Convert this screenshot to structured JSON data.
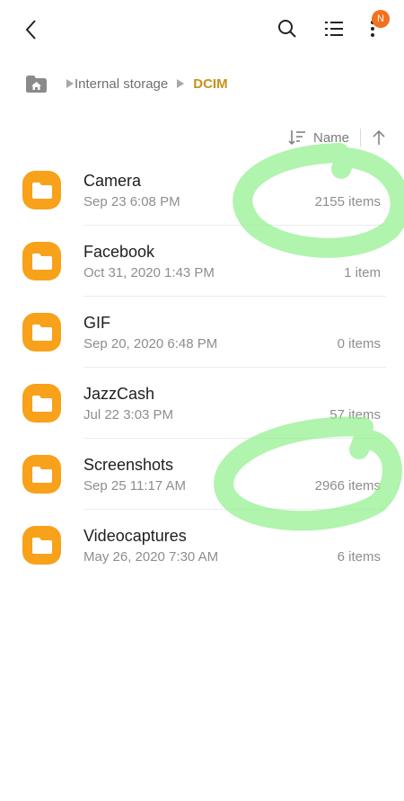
{
  "topbar": {
    "back_icon": "back-arrow-icon",
    "search_icon": "search-icon",
    "list_icon": "list-view-icon",
    "more_icon": "more-vertical-icon",
    "badge": "N",
    "badge_color": "#f2701e"
  },
  "breadcrumb": {
    "home_icon": "home-icon",
    "items": [
      {
        "label": "Internal storage"
      },
      {
        "label": "DCIM"
      }
    ],
    "active_color": "#c8901b"
  },
  "sort": {
    "label": "Name",
    "sort_icon": "sort-order-icon",
    "direction_icon": "arrow-up-icon"
  },
  "folders": [
    {
      "name": "Camera",
      "date": "Sep 23 6:08 PM",
      "count": "2155 items"
    },
    {
      "name": "Facebook",
      "date": "Oct 31, 2020 1:43 PM",
      "count": "1 item"
    },
    {
      "name": "GIF",
      "date": "Sep 20, 2020 6:48 PM",
      "count": "0 items"
    },
    {
      "name": "JazzCash",
      "date": "Jul 22 3:03 PM",
      "count": "57 items"
    },
    {
      "name": "Screenshots",
      "date": "Sep 25 11:17 AM",
      "count": "2966 items"
    },
    {
      "name": "Videocaptures",
      "date": "May 26, 2020 7:30 AM",
      "count": "6 items"
    }
  ],
  "colors": {
    "folder": "#f7a21a",
    "highlight_marker": "#8ef08a"
  }
}
